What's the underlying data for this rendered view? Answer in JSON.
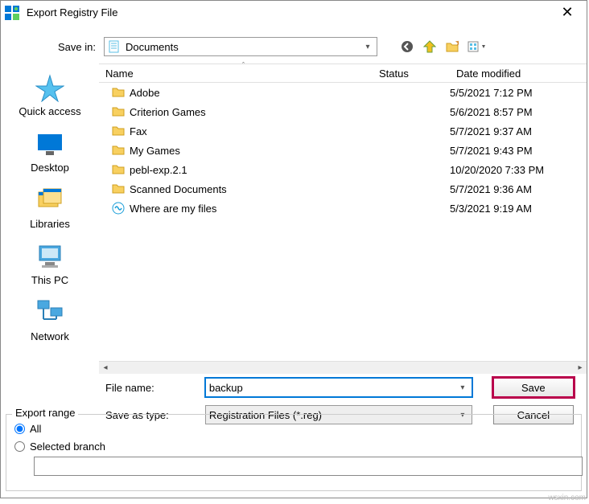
{
  "title": "Export Registry File",
  "savein": {
    "label": "Save in:",
    "value": "Documents"
  },
  "toolbar_icons": [
    "back-icon",
    "recent-icon",
    "new-folder-icon",
    "views-icon"
  ],
  "places": [
    {
      "name": "quick-access",
      "label": "Quick access"
    },
    {
      "name": "desktop",
      "label": "Desktop"
    },
    {
      "name": "libraries",
      "label": "Libraries"
    },
    {
      "name": "this-pc",
      "label": "This PC"
    },
    {
      "name": "network",
      "label": "Network"
    }
  ],
  "columns": {
    "name": "Name",
    "status": "Status",
    "date": "Date modified"
  },
  "files": [
    {
      "type": "folder",
      "name": "Adobe",
      "date": "5/5/2021 7:12 PM"
    },
    {
      "type": "folder",
      "name": "Criterion Games",
      "date": "5/6/2021 8:57 PM"
    },
    {
      "type": "folder",
      "name": "Fax",
      "date": "5/7/2021 9:37 AM"
    },
    {
      "type": "folder",
      "name": "My Games",
      "date": "5/7/2021 9:43 PM"
    },
    {
      "type": "folder",
      "name": "pebl-exp.2.1",
      "date": "10/20/2020 7:33 PM"
    },
    {
      "type": "folder",
      "name": "Scanned Documents",
      "date": "5/7/2021 9:36 AM"
    },
    {
      "type": "link",
      "name": "Where are my files",
      "date": "5/3/2021 9:19 AM"
    }
  ],
  "filename": {
    "label": "File name:",
    "value": "backup"
  },
  "saveastype": {
    "label": "Save as type:",
    "value": "Registration Files (*.reg)"
  },
  "buttons": {
    "save": "Save",
    "cancel": "Cancel"
  },
  "export_range": {
    "legend": "Export range",
    "all": "All",
    "selected": "Selected branch",
    "branch_value": ""
  },
  "selected_radio": "all",
  "watermark": "wsxin.com"
}
